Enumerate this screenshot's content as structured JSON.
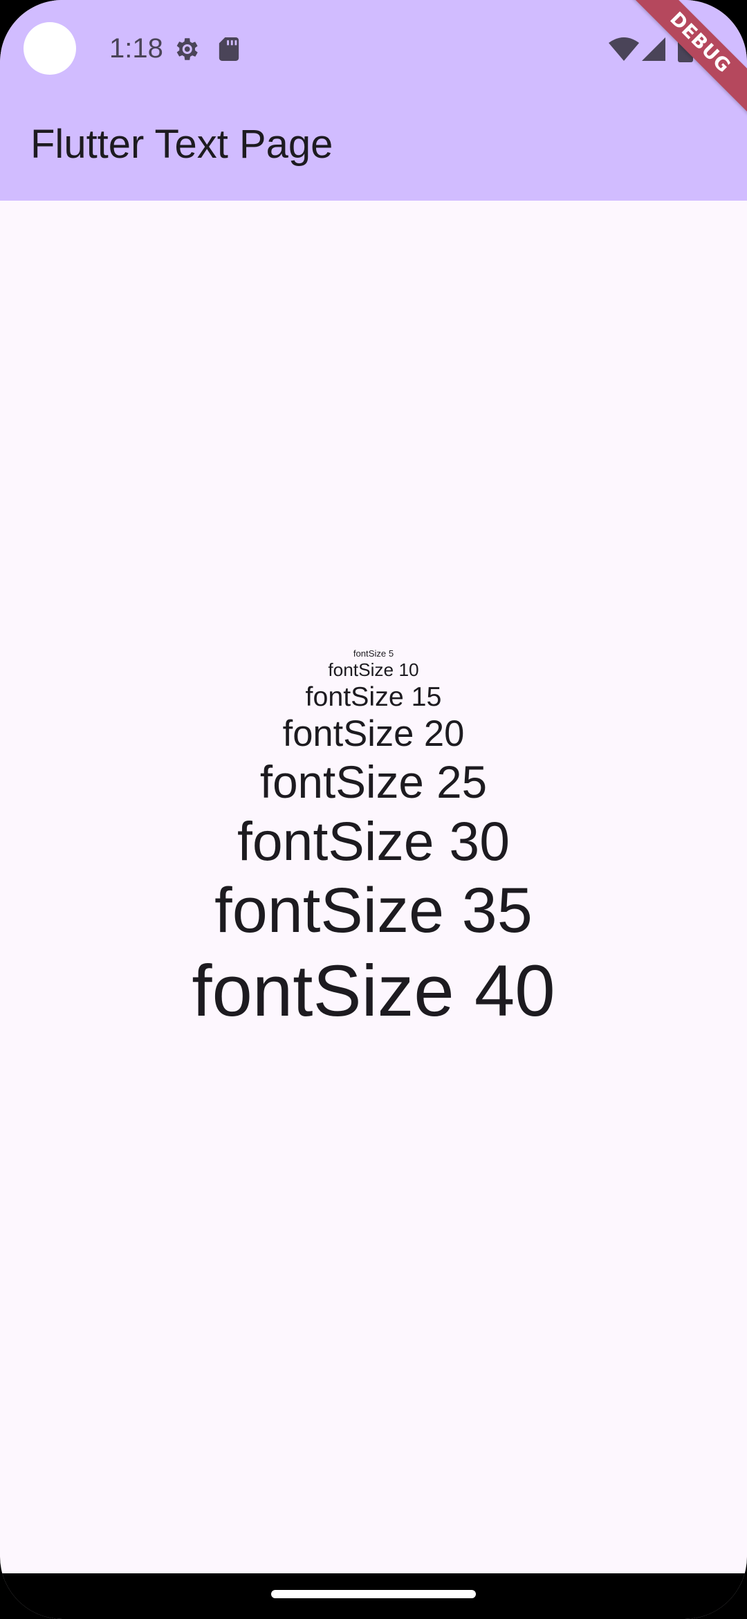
{
  "status_bar": {
    "time": "1:18",
    "icons": [
      "gear-icon",
      "sd-card-icon",
      "wifi-icon",
      "signal-icon",
      "battery-icon"
    ]
  },
  "debug_banner": {
    "label": "DEBUG"
  },
  "app_bar": {
    "title": "Flutter Text Page",
    "background": "#d1bcff"
  },
  "texts": [
    {
      "label": "fontSize 5",
      "size": 5
    },
    {
      "label": "fontSize 10",
      "size": 10
    },
    {
      "label": "fontSize 15",
      "size": 15
    },
    {
      "label": "fontSize 20",
      "size": 20
    },
    {
      "label": "fontSize 25",
      "size": 25
    },
    {
      "label": "fontSize 30",
      "size": 30
    },
    {
      "label": "fontSize 35",
      "size": 35
    },
    {
      "label": "fontSize 40",
      "size": 40
    }
  ],
  "colors": {
    "page_background": "#fdf7fe",
    "text": "#1d1b20",
    "debug_banner": "#b5485d"
  }
}
